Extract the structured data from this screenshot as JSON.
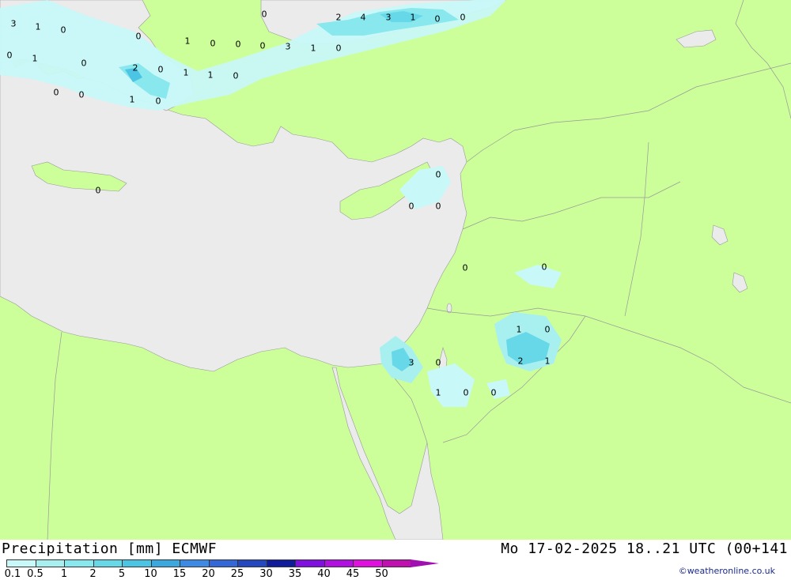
{
  "footer": {
    "title": "Precipitation [mm] ECMWF",
    "datetime": "Mo 17-02-2025 18..21 UTC (00+141",
    "credit": "©weatheronline.co.uk"
  },
  "colors": {
    "land": "#ccff99",
    "sea": "#ebebeb",
    "border": "#999999"
  },
  "legend": {
    "ticks": [
      "0.1",
      "0.5",
      "1",
      "2",
      "5",
      "10",
      "15",
      "20",
      "25",
      "30",
      "35",
      "40",
      "45",
      "50"
    ],
    "colors": [
      "#c8f8f8",
      "#a8f0f0",
      "#88e8ee",
      "#66d8e8",
      "#4cc4e4",
      "#3ca8e0",
      "#3c8ae4",
      "#3468d8",
      "#2448c0",
      "#101c9c",
      "#8010e0",
      "#b010e0",
      "#e010e0",
      "#c010b0"
    ],
    "arrow_color": "#a010b0"
  },
  "precip_labels": [
    {
      "text": "3"
    },
    {
      "text": "1"
    },
    {
      "text": "0"
    },
    {
      "text": "0"
    },
    {
      "text": "1"
    },
    {
      "text": "0"
    },
    {
      "text": "0"
    },
    {
      "text": "2"
    },
    {
      "text": "0"
    },
    {
      "text": "0"
    },
    {
      "text": "0"
    },
    {
      "text": "1"
    },
    {
      "text": "0"
    },
    {
      "text": "0"
    },
    {
      "text": "2"
    },
    {
      "text": "4"
    },
    {
      "text": "3"
    },
    {
      "text": "1"
    },
    {
      "text": "0"
    },
    {
      "text": "0"
    },
    {
      "text": "1"
    },
    {
      "text": "0"
    },
    {
      "text": "0"
    },
    {
      "text": "3"
    },
    {
      "text": "1"
    },
    {
      "text": "0"
    },
    {
      "text": "1"
    },
    {
      "text": "1"
    },
    {
      "text": "0"
    },
    {
      "text": "0"
    },
    {
      "text": "0"
    },
    {
      "text": "0"
    },
    {
      "text": "0"
    },
    {
      "text": "0"
    },
    {
      "text": "0"
    },
    {
      "text": "1"
    },
    {
      "text": "0"
    },
    {
      "text": "0"
    },
    {
      "text": "3"
    },
    {
      "text": "0"
    },
    {
      "text": "2"
    },
    {
      "text": "1"
    },
    {
      "text": "1"
    },
    {
      "text": "0"
    },
    {
      "text": "0"
    }
  ]
}
